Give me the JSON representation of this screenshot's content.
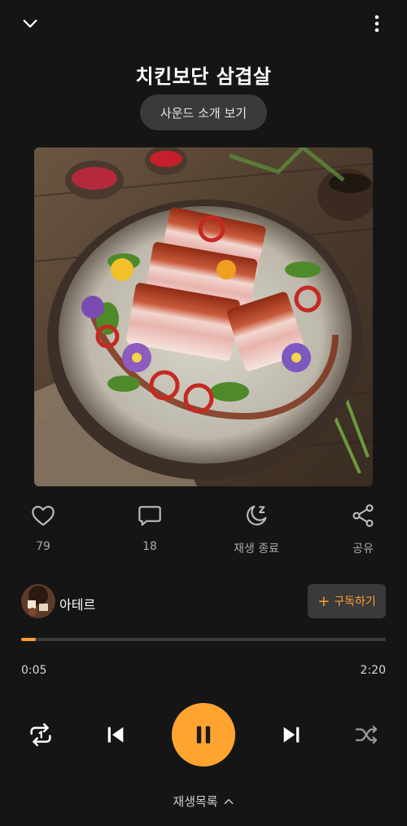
{
  "header": {
    "back_icon": "chevron-down-icon",
    "more_icon": "more-vertical-icon"
  },
  "track": {
    "title": "치킨보단 삼겹살",
    "intro_button": "사운드 소개 보기"
  },
  "actions": {
    "like": {
      "icon": "heart-icon",
      "label": "79"
    },
    "comment": {
      "icon": "comment-icon",
      "label": "18"
    },
    "sleep": {
      "icon": "moon-sleep-icon",
      "label": "재생 종료"
    },
    "share": {
      "icon": "share-icon",
      "label": "공유"
    }
  },
  "artist": {
    "name": "아테르",
    "subscribe_label": "구독하기",
    "subscribe_plus": "+"
  },
  "progress": {
    "current": "0:05",
    "total": "2:20",
    "fraction": 0.04
  },
  "colors": {
    "accent": "#ffa431",
    "background": "#151515",
    "button_bg": "#3a3a3a"
  },
  "controls": {
    "repeat_icon": "repeat-one-icon",
    "prev_icon": "skip-previous-icon",
    "play_icon": "pause-icon",
    "next_icon": "skip-next-icon",
    "shuffle_icon": "shuffle-icon"
  },
  "playlist": {
    "label": "재생목록",
    "icon": "chevron-up-icon"
  }
}
